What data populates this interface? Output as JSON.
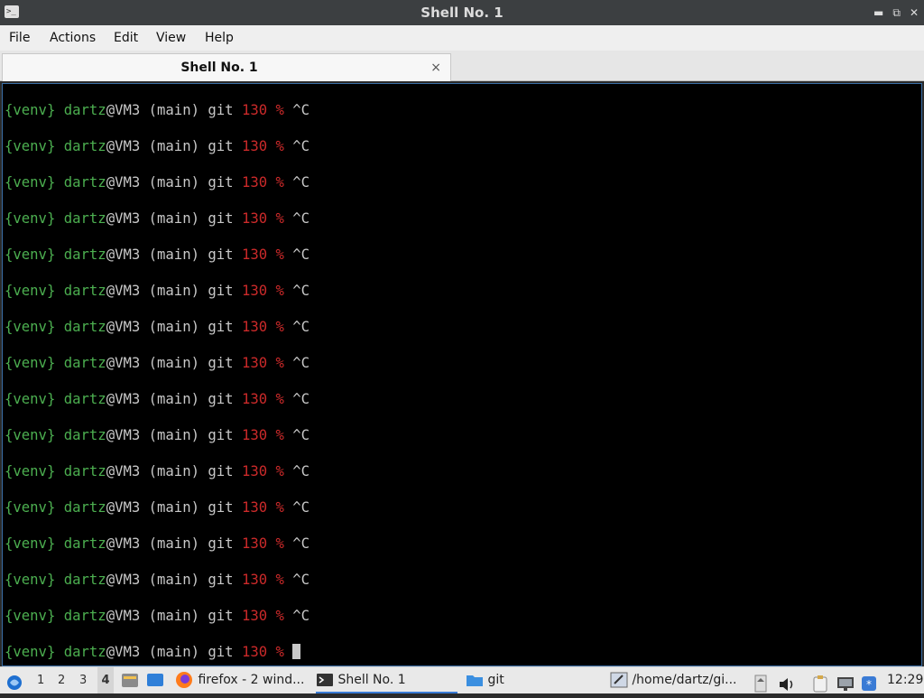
{
  "window": {
    "title": "Shell No. 1"
  },
  "menu": [
    "File",
    "Actions",
    "Edit",
    "View",
    "Help"
  ],
  "tab": {
    "label": "Shell No. 1",
    "close": "×"
  },
  "prompt": {
    "venv": "{venv}",
    "user": "dartz",
    "host": "@VM3",
    "branch": "(main)",
    "dir": "git",
    "status": "130",
    "symbol": "%",
    "input": "^C"
  },
  "history_count": 15,
  "taskbar": {
    "workspaces": [
      "1",
      "2",
      "3",
      "4"
    ],
    "active_workspace": "4",
    "tasks": [
      "firefox - 2 wind...",
      "Shell No. 1",
      "git",
      "/home/dartz/gi..."
    ],
    "clock": "12:29"
  },
  "colors": {
    "prompt_green": "#4caf50",
    "status_red": "#cc2a2a",
    "text": "#c8c8c8",
    "background": "#000000"
  }
}
